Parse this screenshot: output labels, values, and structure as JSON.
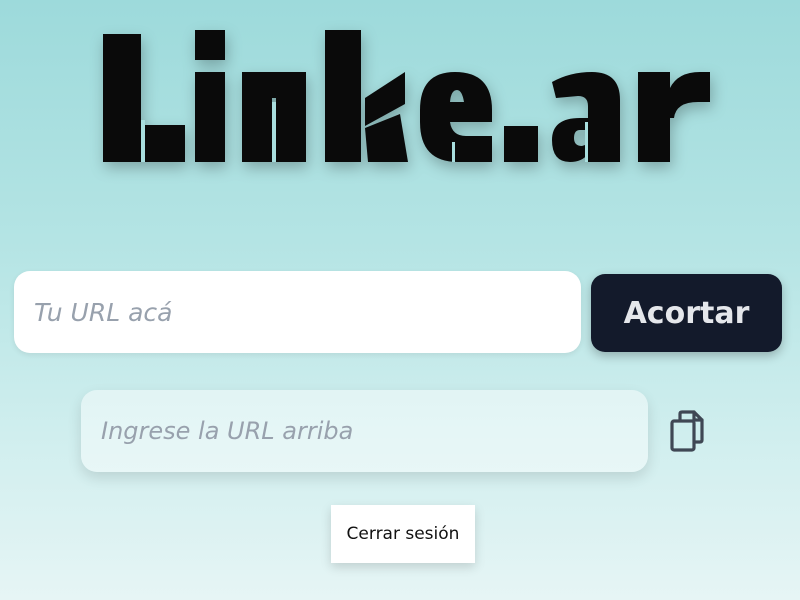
{
  "brand": {
    "logo_text": "Linke.ar",
    "logo_icon": "brand-logo"
  },
  "shortener": {
    "url_placeholder": "Tu URL acá",
    "url_value": "",
    "shorten_label": "Acortar"
  },
  "result": {
    "placeholder": "Ingrese la URL arriba",
    "value": "",
    "copy_icon": "copy-icon"
  },
  "session": {
    "logout_label": "Cerrar sesión"
  },
  "colors": {
    "background_top": "#9ddadb",
    "background_bottom": "#e6f5f5",
    "button_dark": "#131a2b",
    "logo": "#0a0a0a"
  }
}
